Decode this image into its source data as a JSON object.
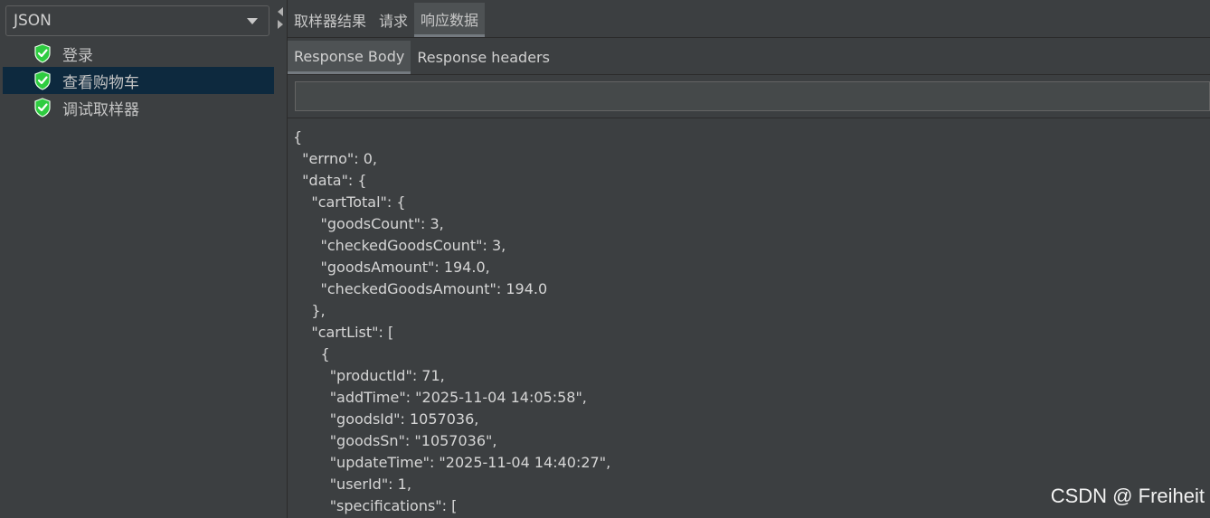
{
  "renderer": {
    "selected": "JSON"
  },
  "tree": {
    "items": [
      {
        "label": "登录",
        "status": "success"
      },
      {
        "label": "查看购物车",
        "status": "success",
        "selected": true
      },
      {
        "label": "调试取样器",
        "status": "success"
      }
    ]
  },
  "tabs": {
    "top": [
      {
        "label": "取样器结果"
      },
      {
        "label": "请求"
      },
      {
        "label": "响应数据",
        "active": true
      }
    ],
    "sub": [
      {
        "label": "Response Body",
        "active": true
      },
      {
        "label": "Response headers"
      }
    ]
  },
  "search": {
    "value": ""
  },
  "response": {
    "lines": [
      "{",
      "  \"errno\": 0,",
      "  \"data\": {",
      "    \"cartTotal\": {",
      "      \"goodsCount\": 3,",
      "      \"checkedGoodsCount\": 3,",
      "      \"goodsAmount\": 194.0,",
      "      \"checkedGoodsAmount\": 194.0",
      "    },",
      "    \"cartList\": [",
      "      {",
      "        \"productId\": 71,",
      "        \"addTime\": \"2025-11-04 14:05:58\",",
      "        \"goodsId\": 1057036,",
      "        \"goodsSn\": \"1057036\",",
      "        \"updateTime\": \"2025-11-04 14:40:27\",",
      "        \"userId\": 1,",
      "        \"specifications\": ["
    ]
  },
  "watermark": "CSDN @ Freiheit",
  "colors": {
    "background": "#3c3f41",
    "selection": "#0d293e",
    "success_icon": "#2ecc40"
  }
}
